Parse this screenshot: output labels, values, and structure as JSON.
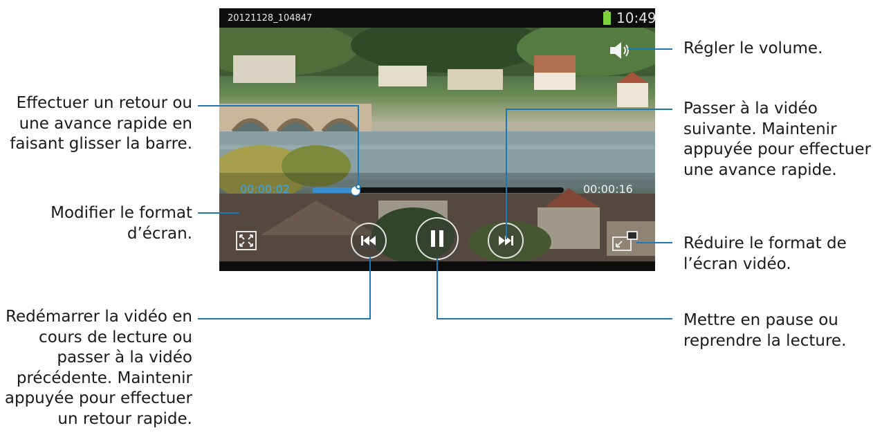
{
  "player": {
    "file_name": "20121128_104847",
    "clock": "10:49",
    "current_time": "00:00:02",
    "total_time": "00:00:16",
    "progress_fraction": 0.17
  },
  "icons": {
    "volume": "speaker-icon",
    "aspect": "fit-screen-icon",
    "previous": "skip-previous-icon",
    "pause": "pause-icon",
    "next": "skip-next-icon",
    "popup": "minimize-screen-icon",
    "battery": "battery-icon"
  },
  "colors": {
    "leader_line": "#1a78b8",
    "current_time": "#3aa7e8",
    "battery": "#7bd23a"
  },
  "callouts": {
    "seek": [
      "Effectuer un retour ou",
      "une avance rapide en",
      "faisant glisser la barre."
    ],
    "aspect": [
      "Modifier le format",
      "d’écran."
    ],
    "previous": [
      "Redémarrer la vidéo en",
      "cours de lecture ou",
      "passer à la vidéo",
      "précédente. Maintenir",
      "appuyée pour effectuer",
      "un retour rapide."
    ],
    "volume": [
      "Régler le volume."
    ],
    "next": [
      "Passer à la vidéo",
      "suivante. Maintenir",
      "appuyée pour effectuer",
      "une avance rapide."
    ],
    "popup": [
      "Réduire le format de",
      "l’écran vidéo."
    ],
    "pause": [
      "Mettre en pause ou",
      "reprendre la lecture."
    ]
  }
}
